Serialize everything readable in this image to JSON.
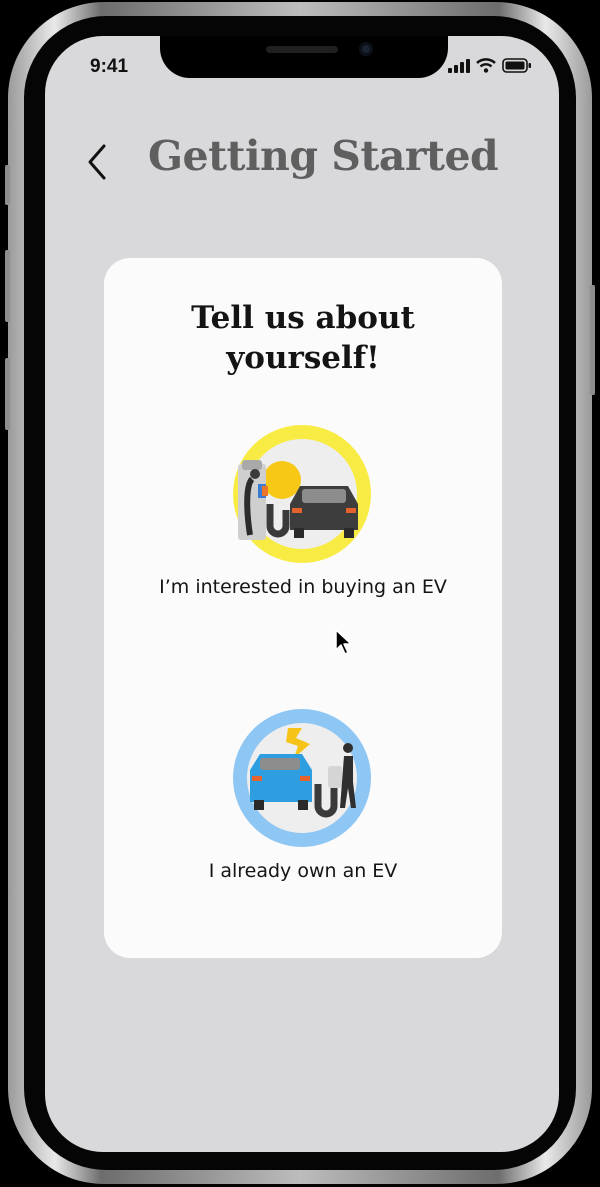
{
  "status_bar": {
    "time": "9:41",
    "icons": [
      "signal-icon",
      "wifi-icon",
      "battery-icon"
    ]
  },
  "header": {
    "back_icon": "chevron-left-icon",
    "title": "Getting Started"
  },
  "card": {
    "title": "Tell us about yourself!",
    "options": [
      {
        "label": "I’m interested in buying an EV",
        "ring_color": "#f8ec44",
        "icon": "ev-buyer-illustration"
      },
      {
        "label": "I already own an EV",
        "ring_color": "#8ec6f4",
        "icon": "ev-owner-illustration"
      }
    ]
  },
  "colors": {
    "screen_bg": "#d9d8db",
    "card_bg": "#fcfbfc",
    "title": "#5f5f60",
    "sun": "#f7c815",
    "bolt": "#f6c418",
    "blue_car": "#2f9ee0"
  }
}
